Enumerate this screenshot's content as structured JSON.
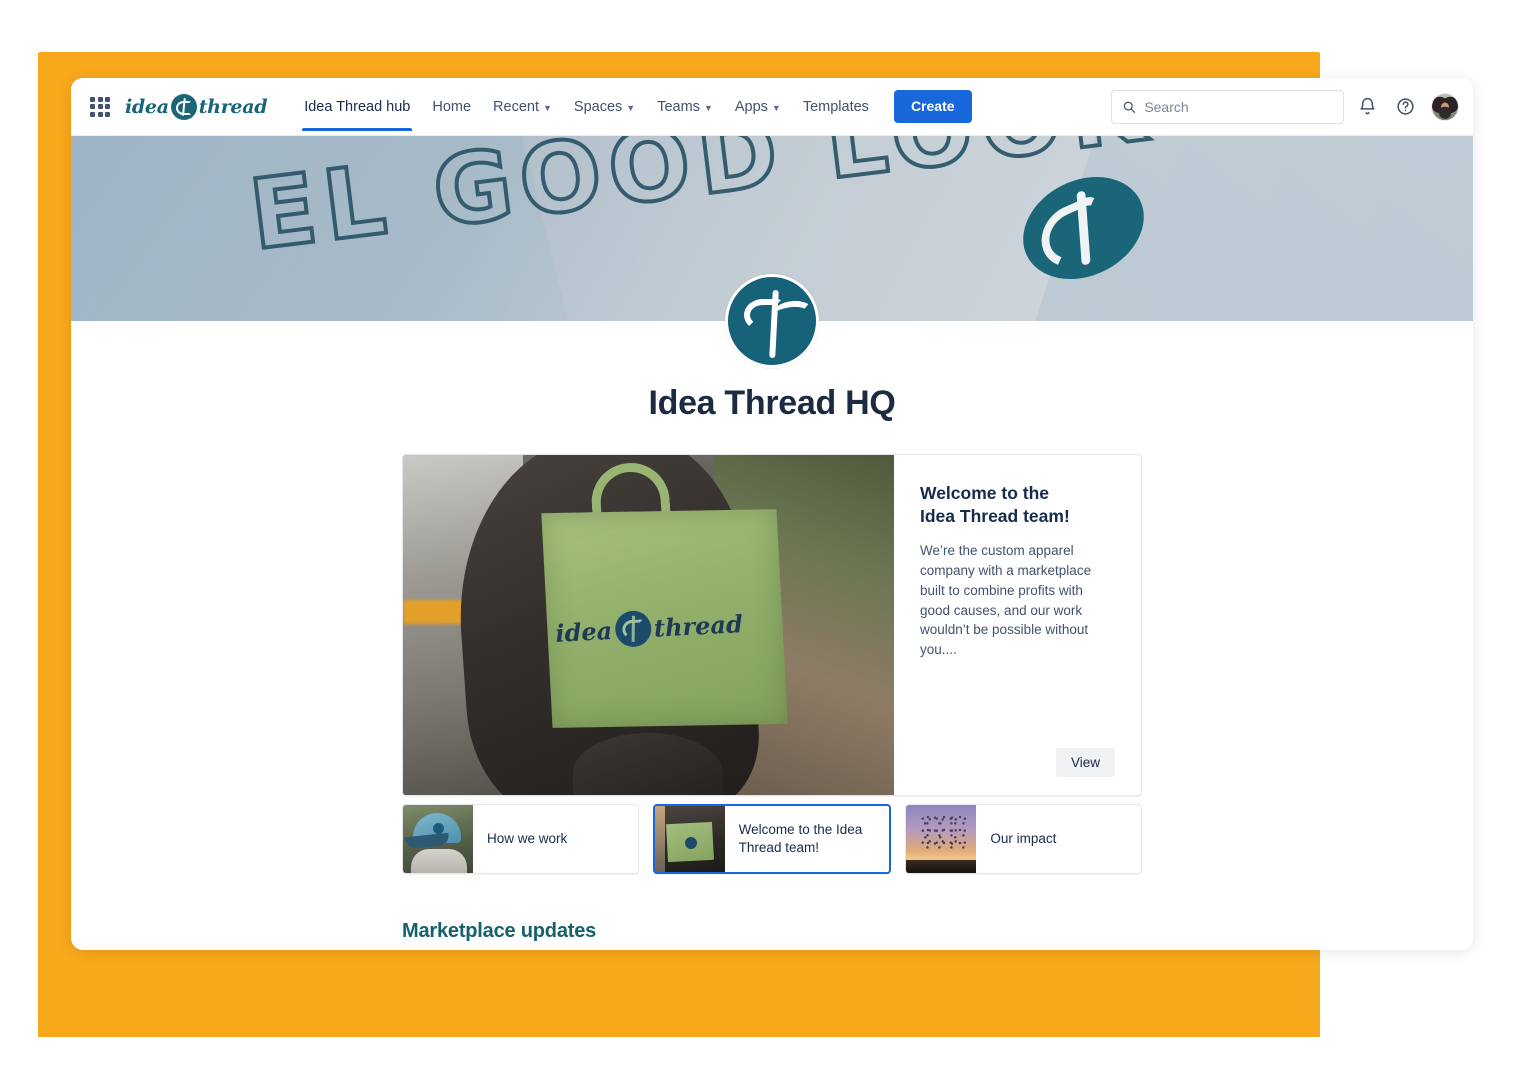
{
  "brand": {
    "word_left": "idea",
    "word_right": "thread",
    "mark_icon": "needle-thread-logo-icon",
    "apps_icon": "apps-grid-icon"
  },
  "topnav": {
    "items": [
      {
        "label": "Idea Thread hub",
        "has_caret": false,
        "active": true
      },
      {
        "label": "Home",
        "has_caret": false,
        "active": false
      },
      {
        "label": "Recent",
        "has_caret": true,
        "active": false
      },
      {
        "label": "Spaces",
        "has_caret": true,
        "active": false
      },
      {
        "label": "Teams",
        "has_caret": true,
        "active": false
      },
      {
        "label": "Apps",
        "has_caret": true,
        "active": false
      },
      {
        "label": "Templates",
        "has_caret": false,
        "active": false
      }
    ],
    "create_label": "Create",
    "search": {
      "value": "",
      "placeholder": "Search",
      "icon": "search-icon"
    },
    "notifications_icon": "bell-icon",
    "help_icon": "help-circle-icon",
    "avatar_icon": "user-avatar"
  },
  "banner": {
    "text": "EL GOOD   LOOK",
    "logo_icon": "needle-thread-logo-icon"
  },
  "page": {
    "logo_icon": "needle-thread-logo-icon",
    "title": "Idea Thread HQ"
  },
  "hero": {
    "image_alt": "person-holding-green-tote-bag",
    "bag_word_left": "idea",
    "bag_word_right": "thread",
    "heading_line1": "Welcome to the",
    "heading_line2": "Idea Thread team!",
    "body": "We’re the custom apparel company with a marketplace built to combine profits with good causes, and our work wouldn’t be possible without you....",
    "view_label": "View"
  },
  "cards": [
    {
      "label": "How we work",
      "thumb": "person-in-blue-cap-photo",
      "selected": false
    },
    {
      "label": "Welcome to the Idea Thread team!",
      "thumb": "green-tote-bag-photo",
      "selected": true
    },
    {
      "label": "Our impact",
      "thumb": "birds-at-sunset-photo",
      "selected": false
    }
  ],
  "section": {
    "marketplace_title": "Marketplace updates"
  },
  "colors": {
    "frame_orange": "#F8A81B",
    "brand_teal": "#156279",
    "accent_blue": "#1868db",
    "section_teal": "#15616d",
    "text_dark": "#172b4d"
  }
}
